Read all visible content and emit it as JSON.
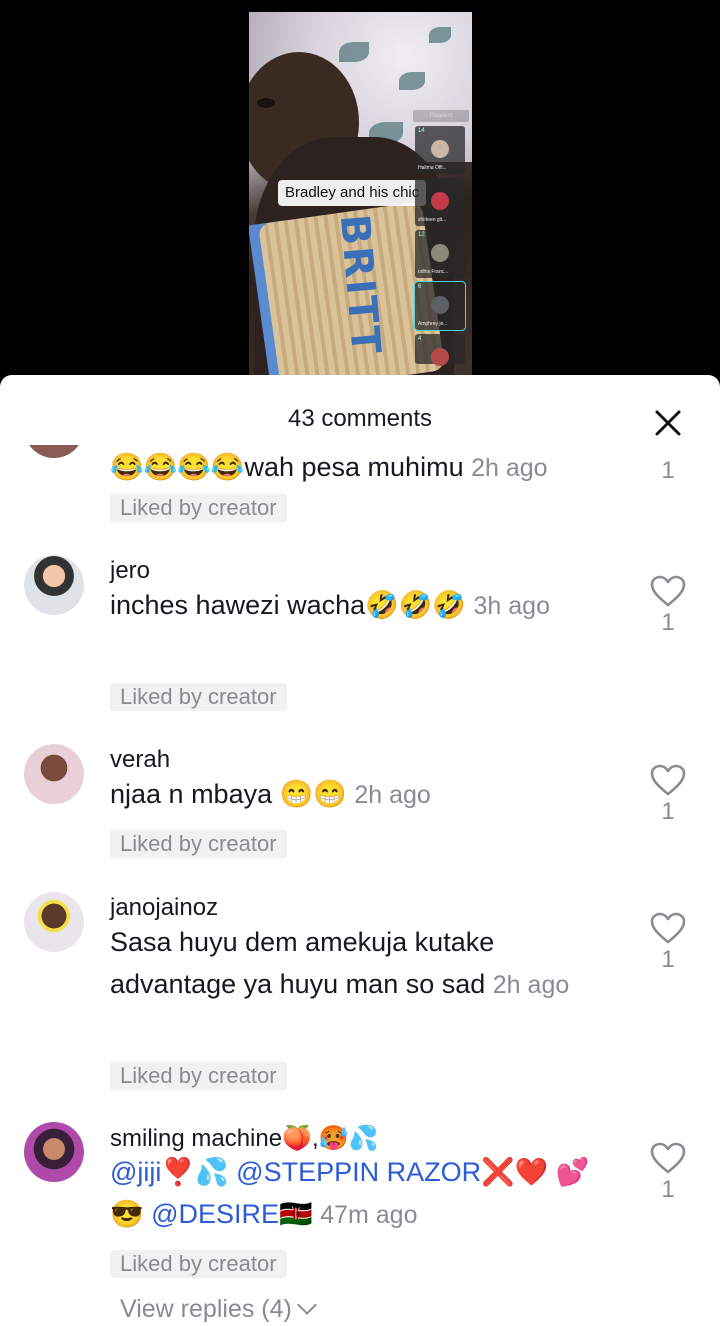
{
  "video": {
    "caption": "Bradley and his chic",
    "panel_header": "Request",
    "jersey_text": "BRITT",
    "guests": [
      {
        "count": "14",
        "name": "Halima Offi..."
      },
      {
        "count": "",
        "name": "shirleen git..."
      },
      {
        "count": "12",
        "name": "odhis Franc..."
      },
      {
        "count": "6",
        "name": "Amphrey je..."
      },
      {
        "count": "4",
        "name": ""
      }
    ]
  },
  "sheet": {
    "title": "43 comments",
    "close_icon": "close-icon",
    "liked_label": "Liked by creator",
    "view_replies": "View replies (4)"
  },
  "comments": [
    {
      "username": "",
      "text": "😂😂😂😂wah pesa muhimu",
      "time": "2h ago",
      "likes": "1"
    },
    {
      "username": "jero",
      "text": "inches hawezi wacha🤣🤣🤣",
      "time": "3h ago",
      "likes": "1"
    },
    {
      "username": "verah",
      "text": "njaa n mbaya 😁😁",
      "time": "2h ago",
      "likes": "1"
    },
    {
      "username": "janojainoz",
      "text": "Sasa huyu dem amekuja kutake advantage ya huyu man so sad",
      "time": "2h ago",
      "likes": "1"
    },
    {
      "username": "smiling machine🍑,🥵💦",
      "text_parts": {
        "m1": "@jiji",
        "e1": "❣️💦 ",
        "m2": "@STEPPIN RAZOR",
        "e2": "❌❤️ 💕😎 ",
        "m3": "@DESIRE",
        "e3": "🇰🇪"
      },
      "time": "47m ago",
      "likes": "1"
    }
  ],
  "colors": {
    "mention": "#2b5bd6",
    "muted": "#8a8b91",
    "text": "#161823"
  }
}
